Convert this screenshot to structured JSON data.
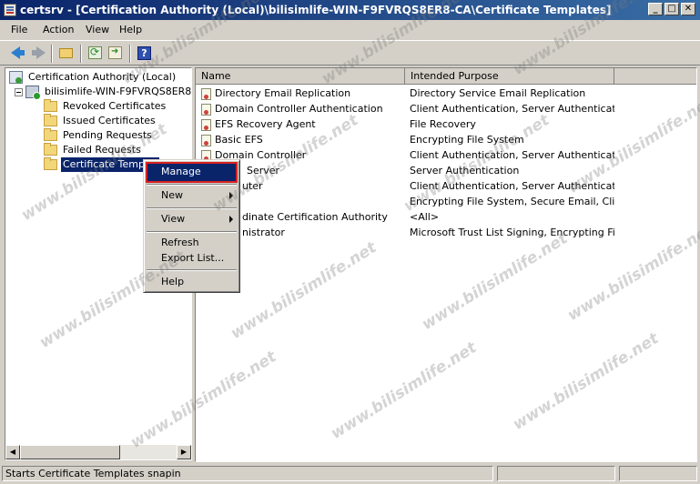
{
  "window": {
    "title": "certsrv - [Certification Authority (Local)\\bilisimlife-WIN-F9FVRQS8ER8-CA\\Certificate Templates]",
    "buttons": {
      "minimize": "_",
      "maximize": "□",
      "close": "✕"
    }
  },
  "menubar": {
    "items": [
      "File",
      "Action",
      "View",
      "Help"
    ]
  },
  "toolbar": {
    "icons": [
      "back-arrow-icon",
      "forward-arrow-icon",
      "up-folder-icon",
      "refresh-icon",
      "export-list-icon",
      "help-icon"
    ]
  },
  "tree": {
    "root": "Certification Authority (Local)",
    "ca": "bilisimlife-WIN-F9FVRQS8ER8-CA",
    "children": [
      "Revoked Certificates",
      "Issued Certificates",
      "Pending Requests",
      "Failed Requests",
      "Certificate Templat"
    ]
  },
  "list": {
    "columns": [
      "Name",
      "Intended Purpose"
    ],
    "rows": [
      {
        "name": "Directory Email Replication",
        "purpose": "Directory Service Email Replication"
      },
      {
        "name": "Domain Controller Authentication",
        "purpose": "Client Authentication, Server Authenticatio..."
      },
      {
        "name": "EFS Recovery Agent",
        "purpose": "File Recovery"
      },
      {
        "name": "Basic EFS",
        "purpose": "Encrypting File System"
      },
      {
        "name": "Domain Controller",
        "purpose": "Client Authentication, Server Authentication"
      },
      {
        "name": "Server",
        "purpose": "Server Authentication"
      },
      {
        "name": "uter",
        "purpose": "Client Authentication, Server Authentication"
      },
      {
        "name": "",
        "purpose": "Encrypting File System, Secure Email, Clien..."
      },
      {
        "name": "dinate Certification Authority",
        "purpose": "<All>"
      },
      {
        "name": "nistrator",
        "purpose": "Microsoft Trust List Signing, Encrypting File..."
      }
    ]
  },
  "context_menu": {
    "items": [
      "Manage",
      "New",
      "View",
      "Refresh",
      "Export List...",
      "Help"
    ]
  },
  "status": {
    "text": "Starts Certificate Templates snapin"
  },
  "watermark": "www.bilisimlife.net",
  "colors": {
    "selection": "#0a246a",
    "highlight_box": "#d82020"
  }
}
